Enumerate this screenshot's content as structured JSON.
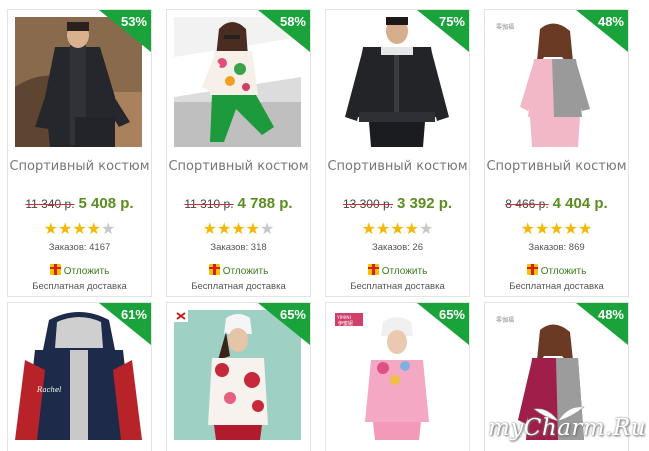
{
  "products": [
    {
      "discount": "53%",
      "title": "Спортивный костюм",
      "old_price": "11 340 р.",
      "price": "5 408 р.",
      "rating": 4,
      "orders": "Заказов: 4167",
      "defer": "Отложить",
      "shipping": "Бесплатная доставка",
      "image_icon": "man-black-tracksuit-photo"
    },
    {
      "discount": "58%",
      "title": "Спортивный костюм",
      "old_price": "11 310 р.",
      "price": "4 788 р.",
      "rating": 4,
      "orders": "Заказов: 318",
      "defer": "Отложить",
      "shipping": "Бесплатная доставка",
      "image_icon": "woman-green-floral-tracksuit-photo"
    },
    {
      "discount": "75%",
      "title": "Спортивный костюм",
      "old_price": "13 300 р.",
      "price": "3 392 р.",
      "rating": 4,
      "orders": "Заказов: 26",
      "defer": "Отложить",
      "shipping": "Бесплатная доставка",
      "image_icon": "man-black-jacket-photo"
    },
    {
      "discount": "48%",
      "title": "Спортивный костюм",
      "old_price": "8 466 р.",
      "price": "4 404 р.",
      "rating": 5,
      "orders": "Заказов: 869",
      "defer": "Отложить",
      "shipping": "Бесплатная доставка",
      "image_icon": "woman-pink-grey-tracksuit-photo"
    },
    {
      "discount": "61%",
      "image_icon": "navy-red-hoodie-photo"
    },
    {
      "discount": "65%",
      "image_icon": "woman-red-floral-hoodie-photo"
    },
    {
      "discount": "65%",
      "image_icon": "woman-pink-floral-tracksuit-photo"
    },
    {
      "discount": "48%",
      "image_icon": "woman-burgundy-grey-tracksuit-photo"
    }
  ],
  "watermark": "myCharm.Ru",
  "colors": {
    "badge": "#1aa33a",
    "price": "#5a8e1e",
    "star": "#f5b800",
    "defer": "#3e7c1a"
  }
}
